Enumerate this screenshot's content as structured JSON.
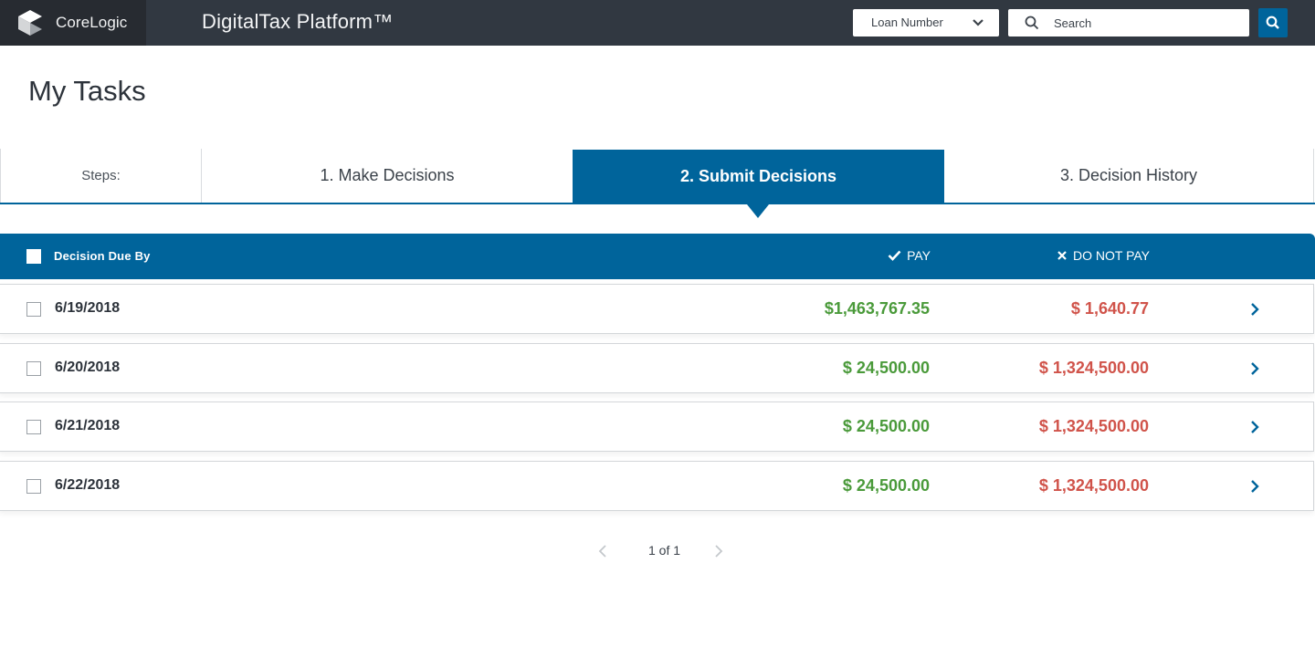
{
  "header": {
    "brand_name": "CoreLogic",
    "app_title": "DigitalTax Platform™",
    "search_type_select": {
      "selected": "Loan Number"
    },
    "search": {
      "placeholder": "Search",
      "value": ""
    },
    "icons": {
      "logo": "corelogic-logo-icon",
      "select_chevron": "chevron-down-icon",
      "search_field": "search-icon",
      "search_button": "search-icon"
    }
  },
  "page": {
    "title": "My Tasks"
  },
  "steps": {
    "label": "Steps:",
    "items": [
      {
        "label": "1.  Make Decisions",
        "active": false
      },
      {
        "label": "2. Submit Decisions",
        "active": true
      },
      {
        "label": "3. Decision History",
        "active": false
      }
    ]
  },
  "table": {
    "columns": {
      "date": "Decision Due By",
      "pay": "PAY",
      "do_not_pay": "DO NOT PAY"
    },
    "rows": [
      {
        "date": "6/19/2018",
        "pay": "$1,463,767.35",
        "do_not_pay": "$ 1,640.77",
        "checked": false
      },
      {
        "date": "6/20/2018",
        "pay": "$ 24,500.00",
        "do_not_pay": "$ 1,324,500.00",
        "checked": false
      },
      {
        "date": "6/21/2018",
        "pay": "$ 24,500.00",
        "do_not_pay": "$ 1,324,500.00",
        "checked": false
      },
      {
        "date": "6/22/2018",
        "pay": "$ 24,500.00",
        "do_not_pay": "$ 1,324,500.00",
        "checked": false
      }
    ]
  },
  "pagination": {
    "text": "1 of 1",
    "current": 1,
    "total": 1
  },
  "colors": {
    "brand_blue": "#00649b",
    "topbar": "#313841",
    "pay_green": "#4a9a3a",
    "do_not_pay_red": "#d0534a"
  }
}
